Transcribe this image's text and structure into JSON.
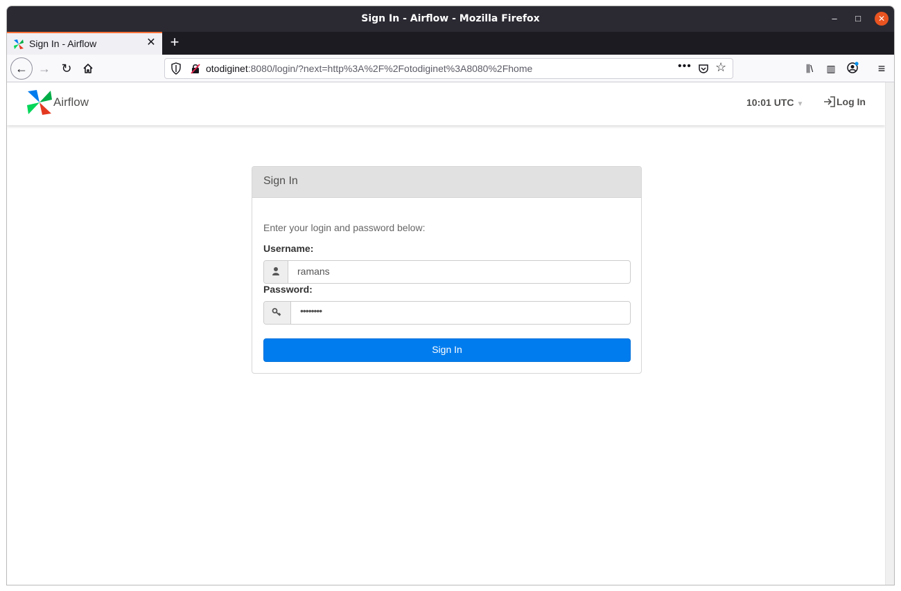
{
  "window": {
    "title": "Sign In - Airflow - Mozilla Firefox",
    "controls": {
      "minimize": "–",
      "maximize": "□",
      "close": "✕"
    }
  },
  "browser": {
    "tab": {
      "title": "Sign In - Airflow",
      "close": "✕"
    },
    "new_tab": "+",
    "nav": {
      "back": "←",
      "forward": "→",
      "reload": "↻",
      "home": "⌂"
    },
    "url": {
      "host": "otodiginet",
      "rest": ":8080/login/?next=http%3A%2F%2Fotodiginet%3A8080%2Fhome",
      "more": "•••",
      "star": "☆"
    },
    "toolbar": {
      "library": "⫼\\",
      "sidebar": "▥",
      "account": "◉",
      "menu": "≡"
    }
  },
  "app": {
    "brand": "Airflow",
    "clock": "10:01 UTC",
    "clock_caret": "▼",
    "login": "Log In"
  },
  "login_form": {
    "heading": "Sign In",
    "intro": "Enter your login and password below:",
    "username_label": "Username:",
    "username_value": "ramans",
    "password_label": "Password:",
    "password_value": "••••••••",
    "submit": "Sign In"
  },
  "colors": {
    "primary": "#017cee",
    "titlebar": "#2b2a33",
    "tab_accent": "#ff7139",
    "close_button": "#e95420"
  }
}
